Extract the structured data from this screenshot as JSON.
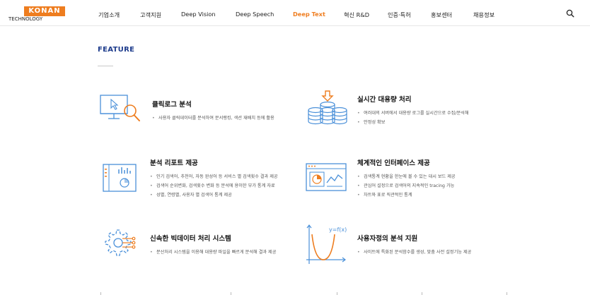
{
  "brand": {
    "logo_main": "KONAN",
    "logo_sub": "TECHNOLOGY",
    "accent_color": "#ee7d1f"
  },
  "nav": {
    "items": [
      {
        "label": "기업소개"
      },
      {
        "label": "고객지원"
      },
      {
        "label": "Deep Vision"
      },
      {
        "label": "Deep Speech"
      },
      {
        "label": "Deep Text",
        "active": true
      },
      {
        "label": "혁신 R&D"
      },
      {
        "label": "인증·특허"
      },
      {
        "label": "홍보센터"
      },
      {
        "label": "채용정보"
      }
    ],
    "search_icon": "search-icon"
  },
  "section": {
    "title": "FEATURE"
  },
  "features": [
    {
      "title": "클릭로그 분석",
      "icon": "monitor-search-icon",
      "bullets": [
        "사용자 클릭데이터를 분석하여 문서랭킹, 색션 재배치 등에 활용"
      ]
    },
    {
      "title": "실시간 대용량 처리",
      "icon": "database-coins-icon",
      "bullets": [
        "여러대의 서버에서 대용량 로그를 실시간으로 수집/분석해",
        "안정성 확보"
      ]
    },
    {
      "title": "분석 리포트 제공",
      "icon": "report-chart-icon",
      "bullets": [
        "인기 검색어, 추천어, 자동 완성어 등 서비스 별 검색횟수 결과 제공",
        "검색어 순위변화, 검색횟수 변화 등 분석에 용이한 부가 통계 자료",
        "성별, 연령별, 사용자 별 검색어 통계 제공"
      ]
    },
    {
      "title": "체계적인 인터페이스 제공",
      "icon": "dashboard-window-icon",
      "bullets": [
        "검색통계 현황을 한눈에 볼 수 있는 대시 보드 제공",
        "관심어 설정으로 검색어의 지속적인 tracing 가능",
        "차트와 표로 직관적인 통계"
      ]
    },
    {
      "title": "신속한 빅데이터 처리 시스템",
      "icon": "gear-circuit-icon",
      "bullets": [
        "분산처리 시스템을 이용해 대용량 파일을 빠르게 분석해 결과 제공"
      ]
    },
    {
      "title": "사용자정의 분석 지원",
      "icon": "function-graph-icon",
      "icon_text": "y=f(x)",
      "bullets": [
        "사이트에 특화된 분석함수를 생성, 맞춤 사전 설정기능 제공"
      ]
    }
  ]
}
